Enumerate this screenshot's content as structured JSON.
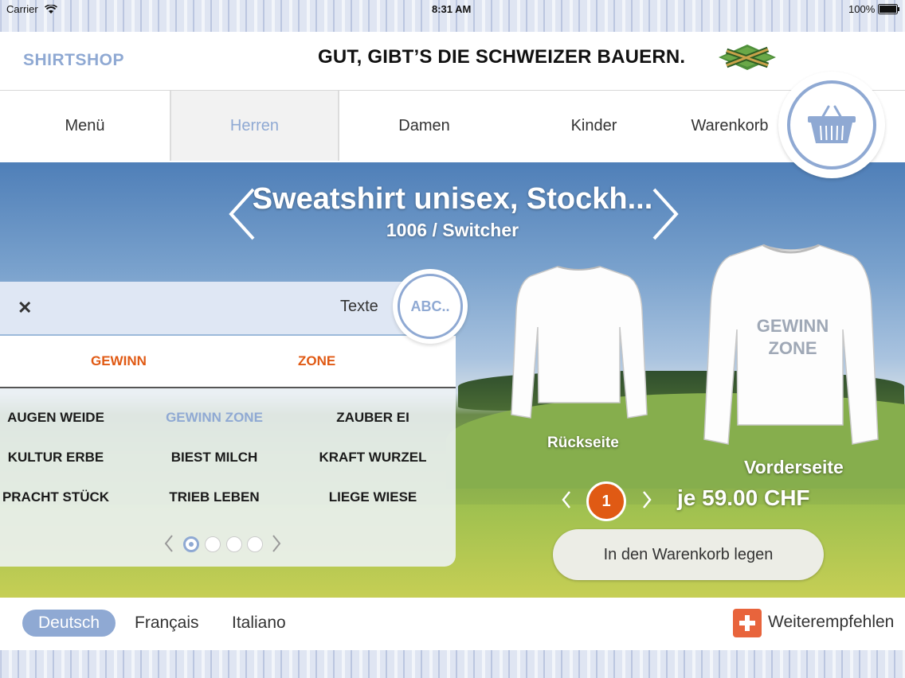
{
  "status_bar": {
    "carrier": "Carrier",
    "time": "8:31 AM",
    "battery": "100%"
  },
  "header": {
    "logo": "SHIRTSHOP",
    "banner": "GUT, GIBT’S DIE SCHWEIZER BAUERN."
  },
  "nav": {
    "items": [
      "Menü",
      "Herren",
      "Damen",
      "Kinder",
      "Warenkorb"
    ],
    "active": "Herren"
  },
  "product": {
    "title": "Sweatshirt unisex, Stockh...",
    "subtitle": "1006 / Switcher",
    "back_label": "Rückseite",
    "front_label": "Vorderseite",
    "print_line1": "GEWINN",
    "print_line2": "ZONE"
  },
  "text_panel": {
    "title": "Texte",
    "abc_button": "ABC..",
    "selected_words": [
      "GEWINN",
      "ZONE"
    ],
    "options": [
      [
        "AUGEN WEIDE",
        "GEWINN ZONE",
        "ZAUBER EI"
      ],
      [
        "KULTUR ERBE",
        "BIEST MILCH",
        "KRAFT WURZEL"
      ],
      [
        "PRACHT STÜCK",
        "TRIEB LEBEN",
        "LIEGE WIESE"
      ]
    ],
    "selected_option": "GEWINN ZONE",
    "page_count": 4,
    "current_page": 1
  },
  "order": {
    "quantity": "1",
    "price": "je 59.00 CHF",
    "add_to_cart": "In den Warenkorb legen"
  },
  "footer": {
    "languages": [
      "Deutsch",
      "Français",
      "Italiano"
    ],
    "active_language": "Deutsch",
    "recommend": "Weiterempfehlen"
  },
  "colors": {
    "accent": "#8fa9d3",
    "highlight": "#e05a14"
  }
}
